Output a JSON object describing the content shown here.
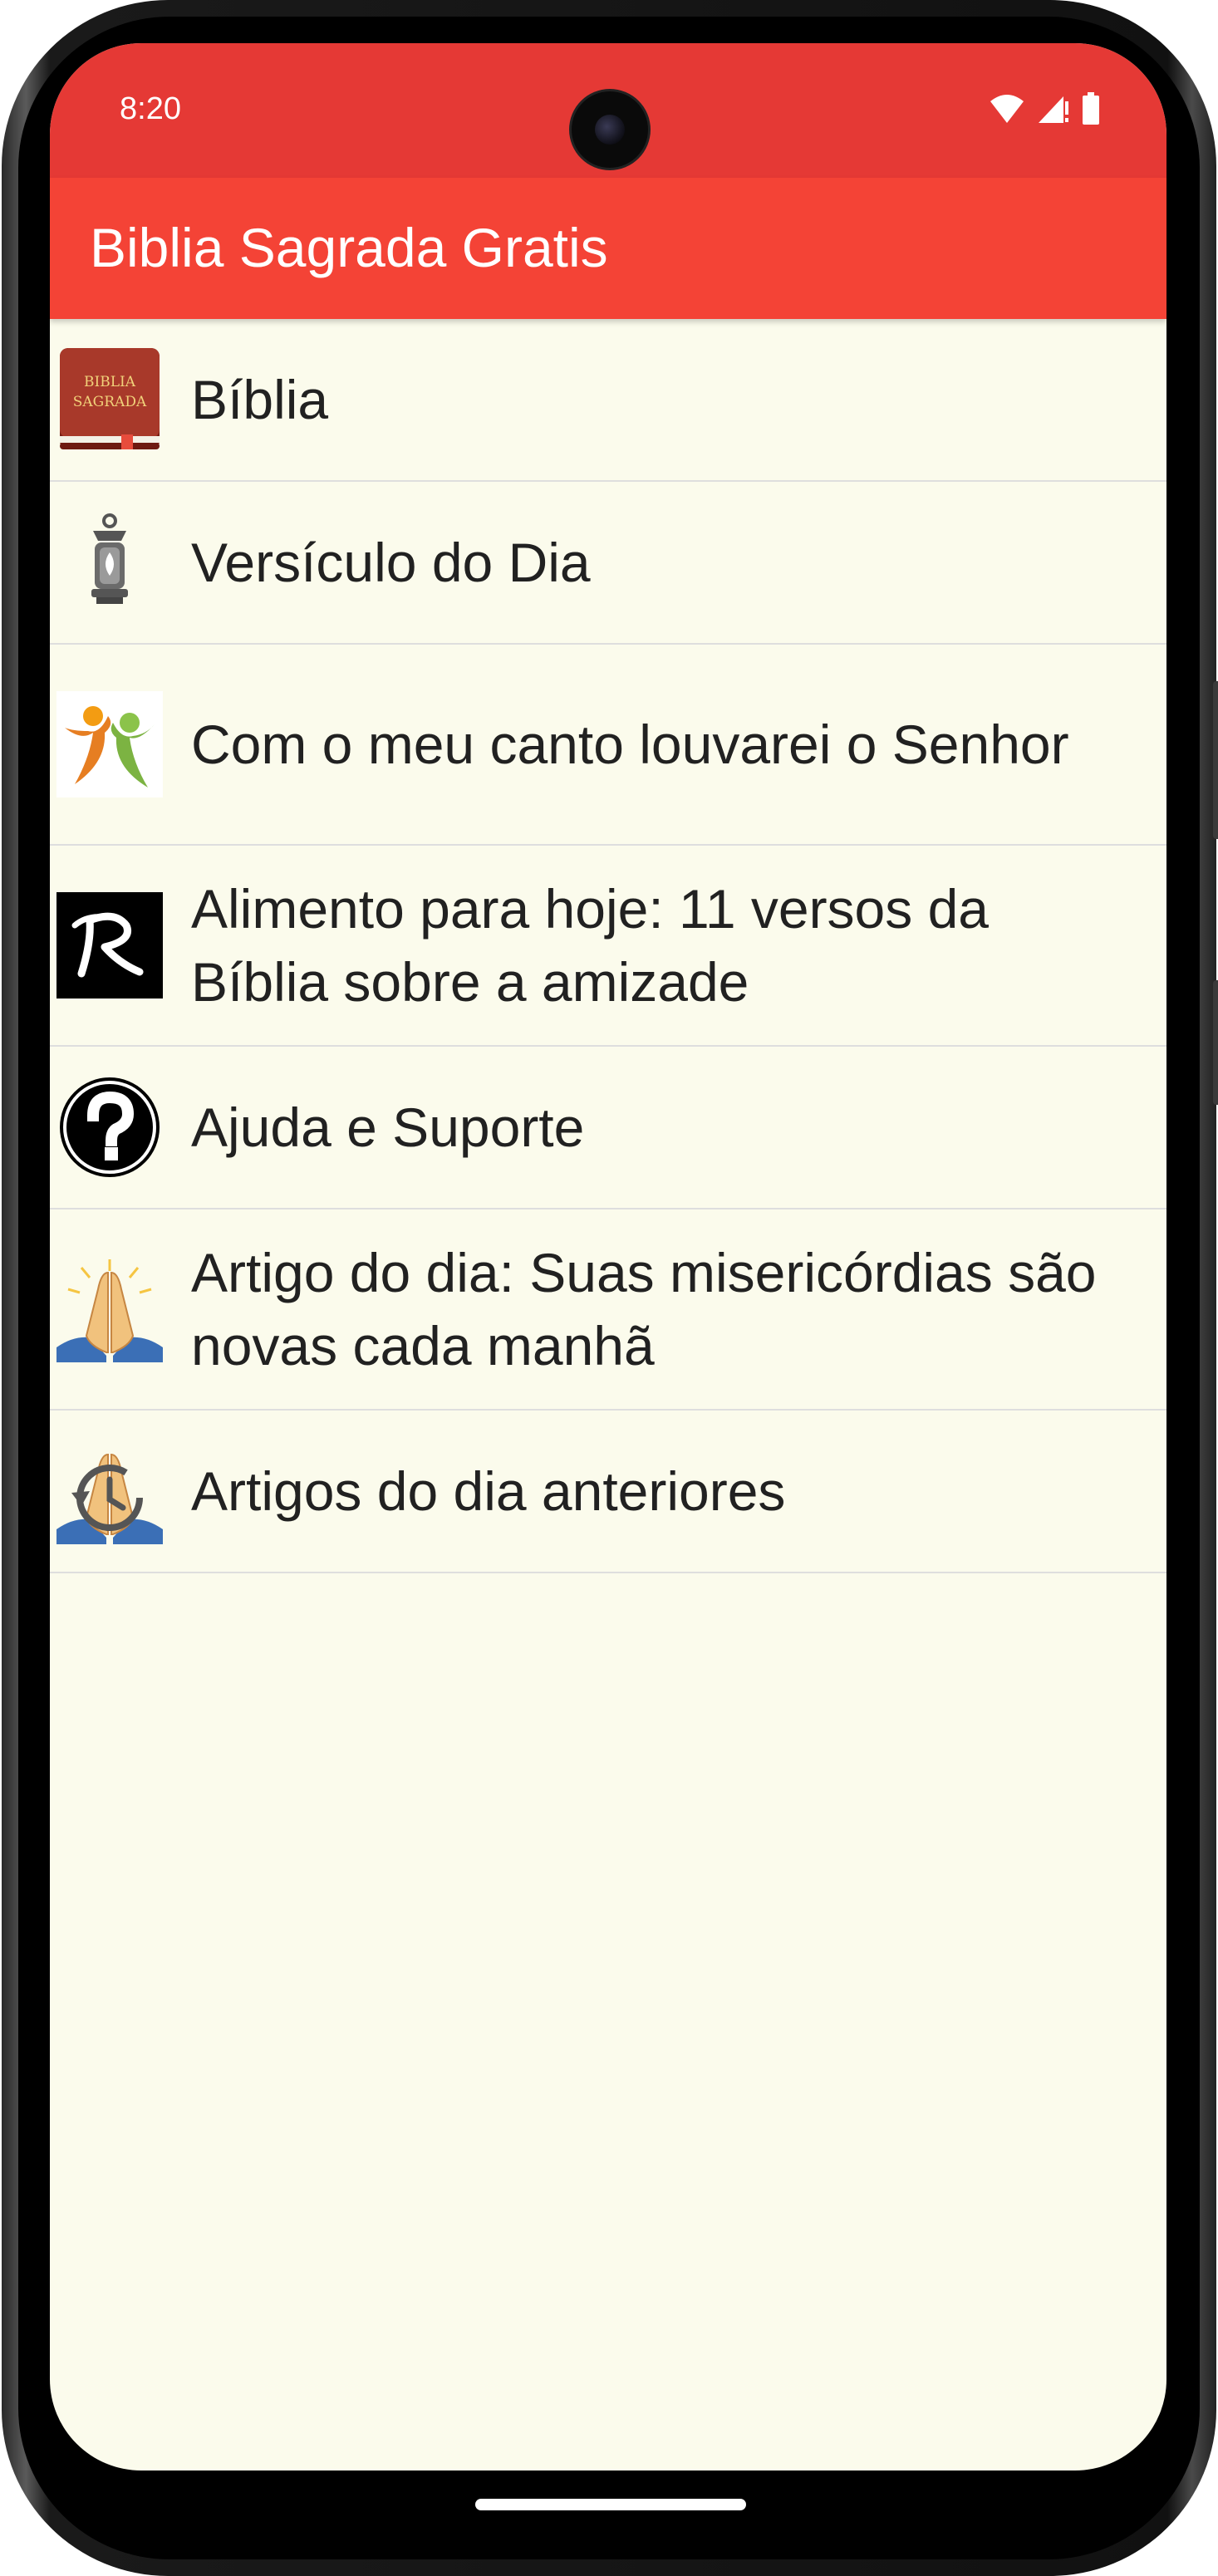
{
  "status_bar": {
    "time": "8:20",
    "icons": [
      "wifi-icon",
      "cell-signal-icon",
      "battery-icon"
    ]
  },
  "app_bar": {
    "title": "Biblia Sagrada Gratis"
  },
  "menu": {
    "items": [
      {
        "label": "Bíblia",
        "icon": "bible-book-icon"
      },
      {
        "label": "Versículo do Dia",
        "icon": "lantern-icon"
      },
      {
        "label": "Com o meu canto louvarei o Senhor",
        "icon": "praise-figures-icon"
      },
      {
        "label": "Alimento para hoje: 11 versos da Bíblia sobre a amizade",
        "icon": "r-logo-icon"
      },
      {
        "label": "Ajuda e Suporte",
        "icon": "help-question-icon"
      },
      {
        "label": "Artigo do dia: Suas misericórdias são novas cada manhã",
        "icon": "praying-hands-icon"
      },
      {
        "label": "Artigos do dia anteriores",
        "icon": "praying-hands-history-icon"
      }
    ],
    "bible_icon_text": [
      "BIBLIA",
      "SAGRADA"
    ]
  },
  "colors": {
    "status_bar": "#e53935",
    "app_bar": "#f44336",
    "list_background": "#fbfbec",
    "divider": "#dedede",
    "text": "#212121"
  }
}
